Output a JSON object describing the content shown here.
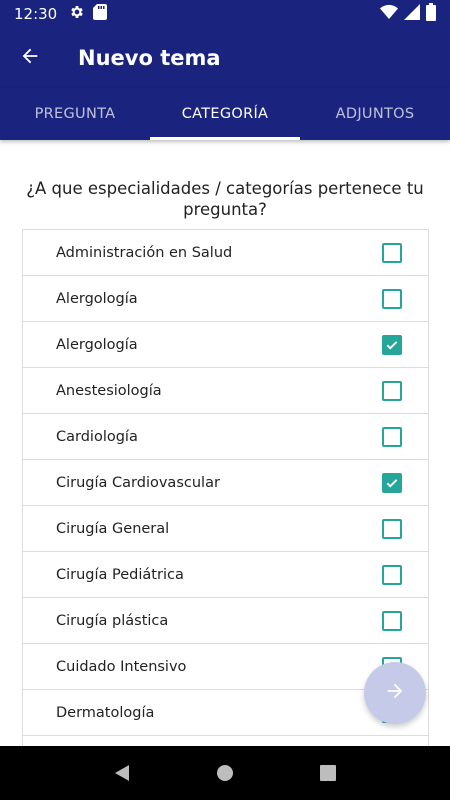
{
  "status_bar": {
    "time": "12:30"
  },
  "app_bar": {
    "title": "Nuevo tema"
  },
  "tabs": [
    {
      "label": "PREGUNTA",
      "active": false
    },
    {
      "label": "CATEGORÍA",
      "active": true
    },
    {
      "label": "ADJUNTOS",
      "active": false
    }
  ],
  "question": "¿A que especialidades / categorías pertenece tu pregunta?",
  "categories": [
    {
      "label": "Administración en Salud",
      "checked": false
    },
    {
      "label": "Alergología",
      "checked": false
    },
    {
      "label": "Alergología",
      "checked": true
    },
    {
      "label": "Anestesiología",
      "checked": false
    },
    {
      "label": "Cardiología",
      "checked": false
    },
    {
      "label": "Cirugía Cardiovascular",
      "checked": true
    },
    {
      "label": "Cirugía General",
      "checked": false
    },
    {
      "label": "Cirugía Pediátrica",
      "checked": false
    },
    {
      "label": "Cirugía plástica",
      "checked": false
    },
    {
      "label": "Cuidado Intensivo",
      "checked": false
    },
    {
      "label": "Dermatología",
      "checked": false
    },
    {
      "label": "",
      "checked": false
    }
  ],
  "colors": {
    "primary": "#1a237e",
    "accent": "#26a69a",
    "fab": "#c5cae9"
  },
  "icons": {
    "back": "arrow-back-icon",
    "fab": "arrow-forward-icon",
    "settings": "gear-icon",
    "sd_card": "sd-card-icon",
    "wifi": "wifi-icon",
    "signal": "signal-icon",
    "battery": "battery-icon"
  }
}
